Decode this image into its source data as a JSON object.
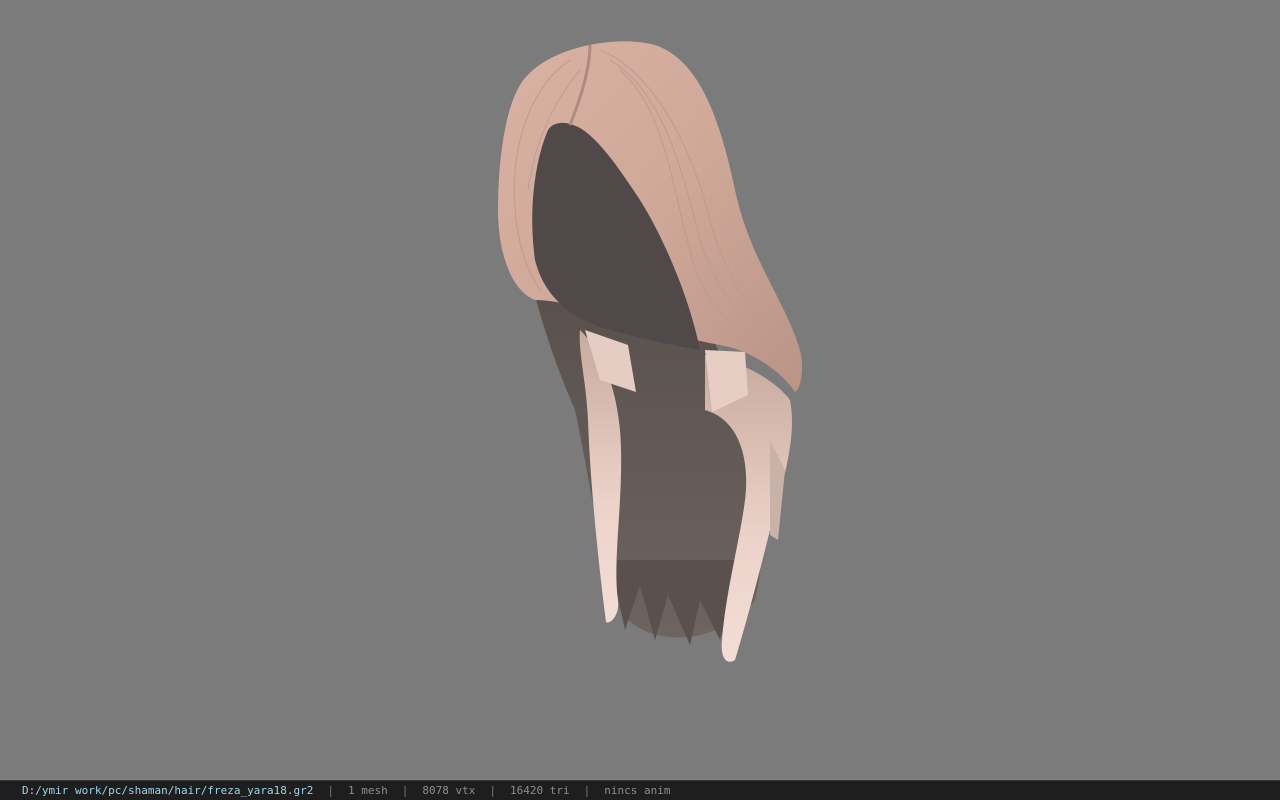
{
  "viewport": {
    "background_color": "#7b7b7b",
    "model": {
      "icon": "hair-mesh-icon",
      "hair_color_light": "#e8c9c0",
      "hair_color_mid": "#c9a497",
      "hair_color_dark": "#5e5550"
    }
  },
  "status_bar": {
    "file_path": "D:/ymir work/pc/shaman/hair/freza_yara18.gr2",
    "separator": "|",
    "mesh_count": "1 mesh",
    "vertex_count": "8078 vtx",
    "triangle_count": "16420 tri",
    "animation": "nincs anim",
    "path_color": "#9fd3e6"
  }
}
